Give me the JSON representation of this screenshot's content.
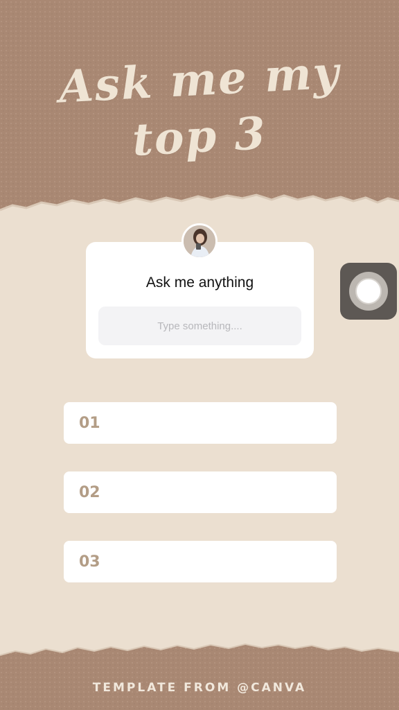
{
  "title": {
    "line1": "Ask me my",
    "line2": "top 3"
  },
  "question_sticker": {
    "title": "Ask me anything",
    "input_placeholder": "Type something...."
  },
  "answers": [
    {
      "label": "01"
    },
    {
      "label": "02"
    },
    {
      "label": "03"
    }
  ],
  "footer": {
    "text": "TEMPLATE FROM @CANVA"
  },
  "colors": {
    "background": "#ebdfd0",
    "paper": "#a98873",
    "title_text": "#efe4d4",
    "answer_number": "#b39d86"
  },
  "icons": {
    "avatar": "profile-photo",
    "assistive_touch": "assistive-touch-icon"
  }
}
